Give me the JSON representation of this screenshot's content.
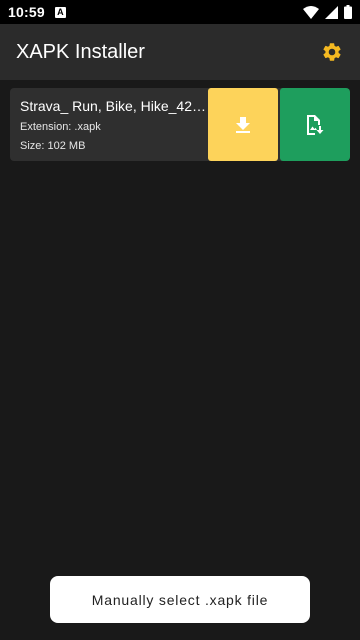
{
  "status_bar": {
    "time": "10:59",
    "notification_icon": "a-notification-icon",
    "icons": [
      "wifi-icon",
      "signal-icon",
      "battery-icon"
    ]
  },
  "app_bar": {
    "title": "XAPK Installer",
    "settings_icon": "gear-icon",
    "accent_color": "#f5b921"
  },
  "file_list": [
    {
      "name": "Strava_ Run, Bike, Hike_421...",
      "extension": "Extension: .xapk",
      "size": "Size: 102 MB",
      "install_icon": "download-icon",
      "select_icon": "file-image-download-icon",
      "install_color": "#fdd35a",
      "select_color": "#1e9e5d"
    }
  ],
  "footer": {
    "manual_select_label": "Manually select .xapk file"
  }
}
